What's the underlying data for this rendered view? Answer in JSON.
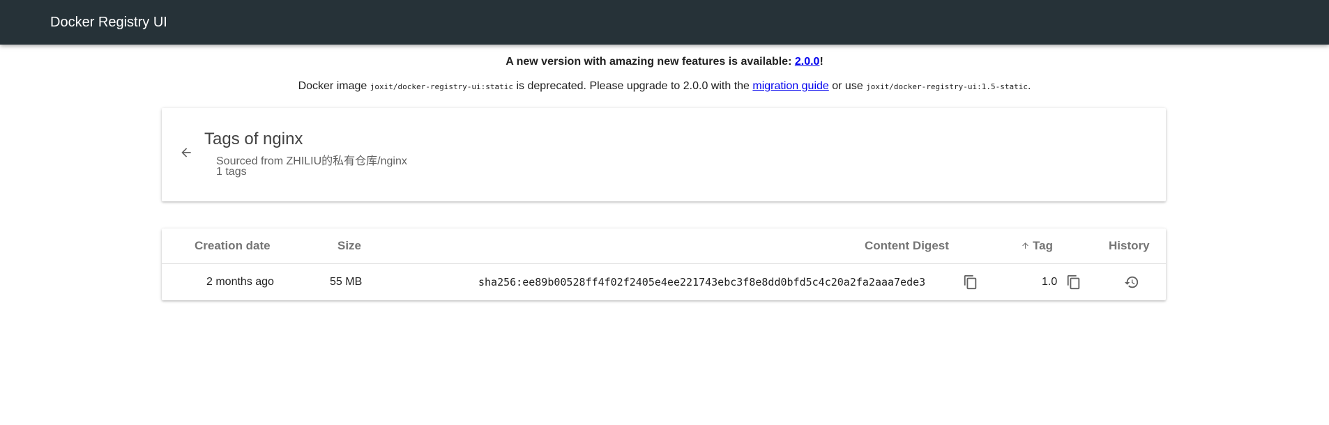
{
  "app": {
    "title": "Docker Registry UI"
  },
  "notice": {
    "text_prefix": "A new version with amazing new features is available: ",
    "version_link": "2.0.0",
    "text_suffix": "!"
  },
  "deprecation": {
    "part1": "Docker image ",
    "image_old": "joxit/docker-registry-ui:static",
    "part2": " is deprecated. Please upgrade to 2.0.0 with the ",
    "migration_link": "migration guide",
    "part3": " or use ",
    "image_new": "joxit/docker-registry-ui:1.5-static",
    "part4": "."
  },
  "header": {
    "back_icon": "arrow-left-icon",
    "title": "Tags of nginx",
    "source": "Sourced from ZHILIU的私有仓库/nginx",
    "count": "1 tags"
  },
  "table": {
    "columns": {
      "creation_date": "Creation date",
      "size": "Size",
      "content_digest": "Content Digest",
      "tag": "Tag",
      "tag_sort_icon": "arrow-up-icon",
      "history": "History"
    },
    "rows": [
      {
        "creation_date": "2 months ago",
        "size": "55 MB",
        "content_digest": "sha256:ee89b00528ff4f02f2405e4ee221743ebc3f8e8dd0bfd5c4c20a2fa2aaa7ede3",
        "tag": "1.0",
        "copy_icon": "copy-icon",
        "history_icon": "history-icon"
      }
    ]
  }
}
